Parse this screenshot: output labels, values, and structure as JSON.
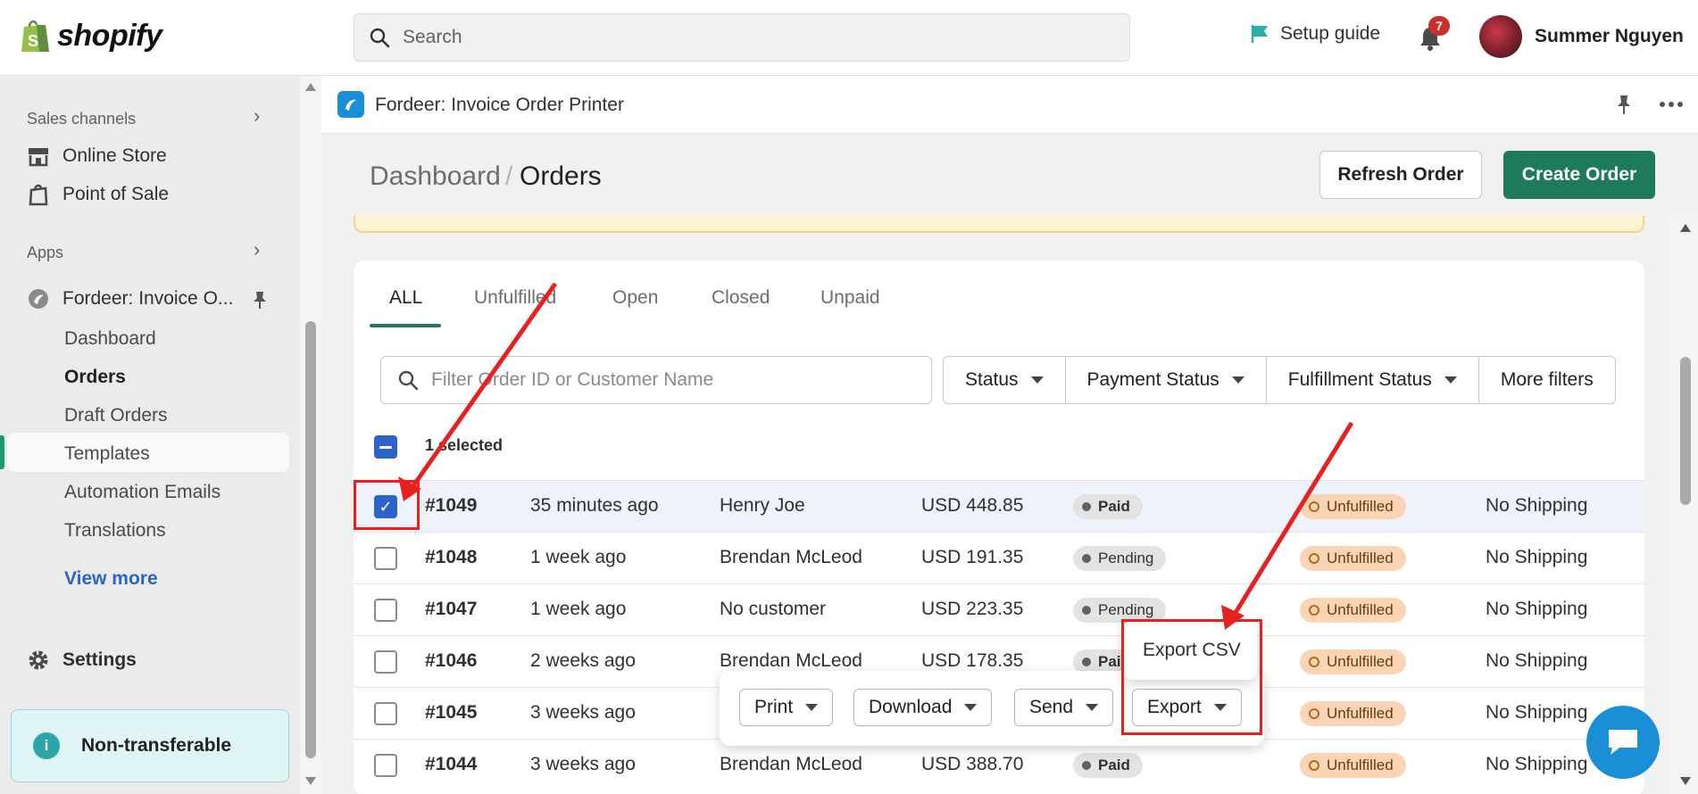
{
  "topbar": {
    "logo_text": "shopify",
    "search_placeholder": "Search",
    "setup_guide": "Setup guide",
    "notification_count": "7",
    "user_name": "Summer Nguyen"
  },
  "sidebar": {
    "sales_channels": "Sales channels",
    "online_store": "Online Store",
    "point_of_sale": "Point of Sale",
    "apps": "Apps",
    "app_name": "Fordeer: Invoice O...",
    "sub_items": [
      "Dashboard",
      "Orders",
      "Draft Orders",
      "Templates",
      "Automation Emails",
      "Translations"
    ],
    "active_item": "Orders",
    "view_more": "View more",
    "settings": "Settings",
    "non_transferable": "Non-transferable"
  },
  "appbar": {
    "title": "Fordeer: Invoice Order Printer"
  },
  "page": {
    "breadcrumb_parent": "Dashboard",
    "breadcrumb_sep": "/",
    "breadcrumb_current": "Orders",
    "refresh_button": "Refresh Order",
    "create_button": "Create Order"
  },
  "tabs": [
    "ALL",
    "Unfulfilled",
    "Open",
    "Closed",
    "Unpaid"
  ],
  "filters": {
    "search_placeholder": "Filter Order ID or Customer Name",
    "buttons": [
      "Status",
      "Payment Status",
      "Fulfillment Status",
      "More filters"
    ]
  },
  "selection": {
    "label": "1 selected"
  },
  "orders": [
    {
      "id": "#1049",
      "time": "35 minutes ago",
      "customer": "Henry Joe",
      "total": "USD 448.85",
      "payment": "Paid",
      "fulfillment": "Unfulfilled",
      "shipping": "No Shipping",
      "checked": true
    },
    {
      "id": "#1048",
      "time": "1 week ago",
      "customer": "Brendan McLeod",
      "total": "USD 191.35",
      "payment": "Pending",
      "fulfillment": "Unfulfilled",
      "shipping": "No Shipping",
      "checked": false
    },
    {
      "id": "#1047",
      "time": "1 week ago",
      "customer": "No customer",
      "total": "USD 223.35",
      "payment": "Pending",
      "fulfillment": "Unfulfilled",
      "shipping": "No Shipping",
      "checked": false
    },
    {
      "id": "#1046",
      "time": "2 weeks ago",
      "customer": "Brendan McLeod",
      "total": "USD 178.35",
      "payment": "Paid",
      "fulfillment": "Unfulfilled",
      "shipping": "No Shipping",
      "checked": false
    },
    {
      "id": "#1045",
      "time": "3 weeks ago",
      "customer": "",
      "total": "",
      "payment": "",
      "fulfillment": "Unfulfilled",
      "shipping": "No Shipping",
      "checked": false
    },
    {
      "id": "#1044",
      "time": "3 weeks ago",
      "customer": "Brendan McLeod",
      "total": "USD 388.70",
      "payment": "Paid",
      "fulfillment": "Unfulfilled",
      "shipping": "No Shipping",
      "checked": false
    }
  ],
  "bulk_actions": [
    "Print",
    "Download",
    "Send",
    "Export"
  ],
  "export_menu": {
    "item": "Export CSV"
  },
  "colors": {
    "primary": "#1d7a5a",
    "annotation": "#e82020",
    "link": "#2a63c9"
  }
}
